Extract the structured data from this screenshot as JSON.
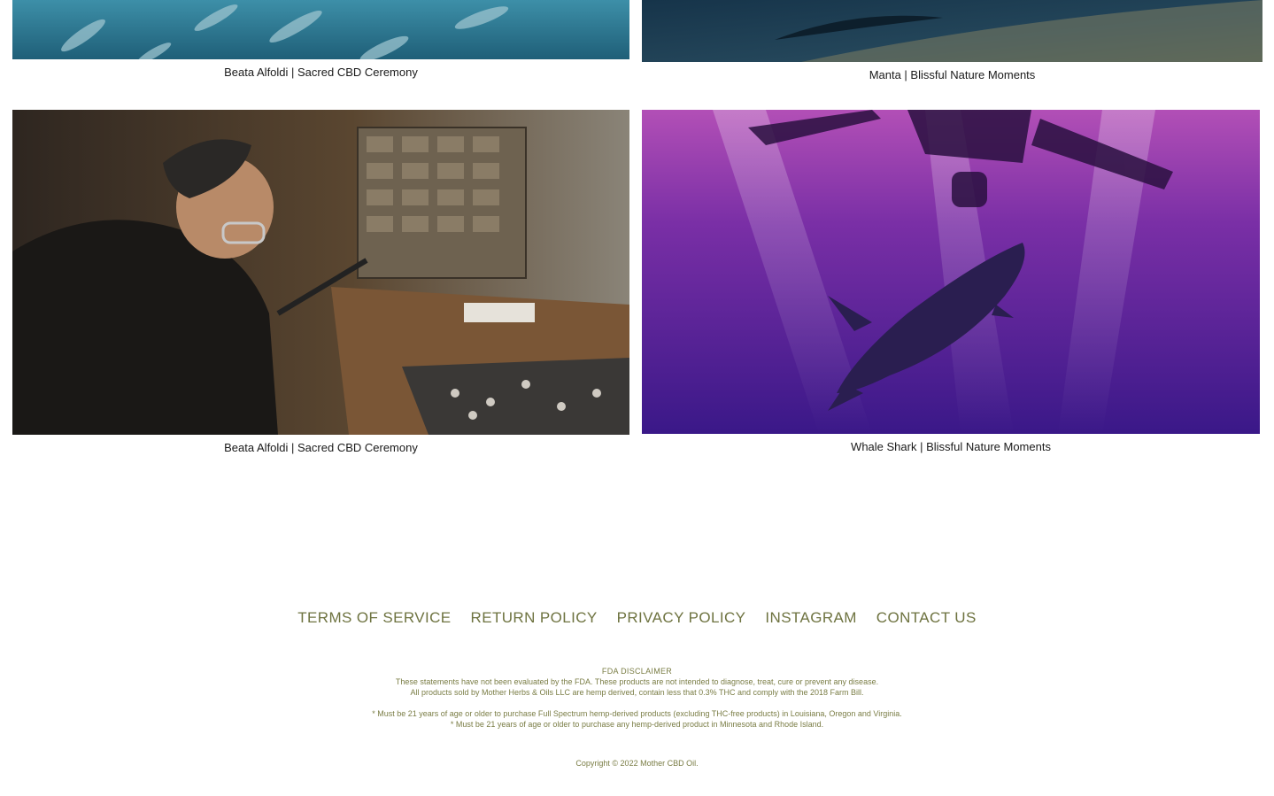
{
  "gallery": {
    "items": [
      {
        "caption": "Beata Alfoldi | Sacred CBD Ceremony"
      },
      {
        "caption": "Manta | Blissful Nature Moments"
      },
      {
        "caption": "Beata Alfoldi | Sacred CBD Ceremony"
      },
      {
        "caption": "Whale Shark | Blissful Nature Moments"
      }
    ]
  },
  "footer": {
    "links": [
      "TERMS OF SERVICE",
      "RETURN POLICY",
      "PRIVACY POLICY",
      "INSTAGRAM",
      "CONTACT US"
    ],
    "disclaimer_title": "FDA DISCLAIMER",
    "disclaimer_lines": [
      "These statements have not been evaluated by the FDA. These products are not intended to diagnose, treat, cure or prevent any disease.",
      "All products sold by Mother Herbs & Oils LLC are hemp derived, contain less that 0.3% THC and comply with the 2018 Farm Bill."
    ],
    "age_notes": [
      "* Must be 21 years of age or older to purchase Full Spectrum hemp-derived products (excluding THC-free products) in Louisiana, Oregon and Virginia.",
      "* Must be 21 years of age or older to purchase any hemp-derived product in Minnesota and Rhode Island."
    ],
    "copyright": "Copyright © 2022 Mother CBD Oil."
  },
  "colors": {
    "footer_text": "#6e7340",
    "caption_text": "#1a1a1a"
  }
}
